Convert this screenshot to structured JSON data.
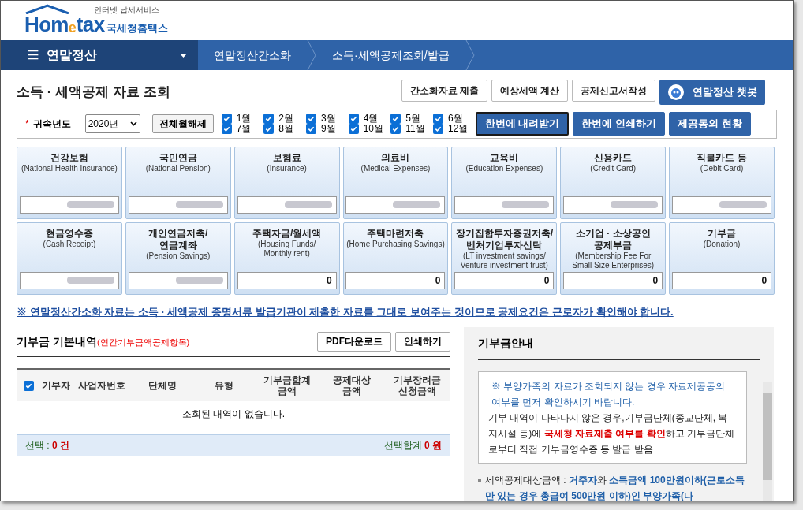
{
  "logo": {
    "tagline": "인터넷 납세서비스",
    "brand_a": "Hom",
    "brand_e": "e",
    "brand_b": "tax",
    "brand_kr": "국세청홈택스"
  },
  "nav": {
    "menu_icon": "☰",
    "menu": "연말정산",
    "crumbs": [
      "연말정산간소화",
      "소득·세액공제조회/발급"
    ]
  },
  "title": "소득 · 세액공제 자료 조회",
  "actions": [
    {
      "label": "간소화자료 제출",
      "kind": "plain"
    },
    {
      "label": "예상세액 계산",
      "kind": "plain"
    },
    {
      "label": "공제신고서작성",
      "kind": "plain"
    },
    {
      "label": "연말정산 챗봇",
      "kind": "chatbot"
    }
  ],
  "filter": {
    "required_mark": "*",
    "label": "귀속년도",
    "year": "2020년",
    "toggle_button": "전체월해제",
    "months": [
      {
        "label": "1월",
        "checked": true
      },
      {
        "label": "2월",
        "checked": true
      },
      {
        "label": "3월",
        "checked": true
      },
      {
        "label": "4월",
        "checked": true
      },
      {
        "label": "5월",
        "checked": true
      },
      {
        "label": "6월",
        "checked": true
      },
      {
        "label": "7월",
        "checked": true
      },
      {
        "label": "8월",
        "checked": true
      },
      {
        "label": "9월",
        "checked": true
      },
      {
        "label": "10월",
        "checked": true
      },
      {
        "label": "11월",
        "checked": true
      },
      {
        "label": "12월",
        "checked": true
      }
    ],
    "buttons": [
      {
        "label": "한번에 내려받기",
        "selected": true
      },
      {
        "label": "한번에 인쇄하기",
        "selected": false
      },
      {
        "label": "제공동의 현황",
        "selected": false
      }
    ]
  },
  "cards": [
    {
      "title": "건강보험",
      "subtitle": "(National Health Insurance)",
      "masked": true
    },
    {
      "title": "국민연금",
      "subtitle": "(National Pension)",
      "masked": true
    },
    {
      "title": "보험료",
      "subtitle": "(Insurance)",
      "masked": true
    },
    {
      "title": "의료비",
      "subtitle": "(Medical Expenses)",
      "masked": true
    },
    {
      "title": "교육비",
      "subtitle": "(Education Expenses)",
      "masked": true
    },
    {
      "title": "신용카드",
      "subtitle": "(Credit Card)",
      "masked": true
    },
    {
      "title": "직불카드 등",
      "subtitle": "(Debit Card)",
      "masked": true
    },
    {
      "title": "현금영수증",
      "subtitle": "(Cash Receipt)",
      "masked": true
    },
    {
      "title": "개인연금저축/\n연금계좌",
      "subtitle": "(Pension Savings)",
      "masked": true
    },
    {
      "title": "주택자금/월세액",
      "subtitle": "(Housing Funds/\nMonthly rent)",
      "value": "0",
      "masked": false
    },
    {
      "title": "주택마련저축",
      "subtitle": "(Home Purchasing Savings)",
      "value": "0",
      "masked": false
    },
    {
      "title": "장기집합투자증권저축/\n벤처기업투자신탁",
      "subtitle": "(LT investment savings/\nVenture investment trust)",
      "value": "0",
      "masked": false
    },
    {
      "title": "소기업 · 소상공인\n공제부금",
      "subtitle": "(Membership Fee For\nSmall Size Enterprises)",
      "value": "0",
      "masked": false
    },
    {
      "title": "기부금",
      "subtitle": "(Donation)",
      "value": "0",
      "masked": false
    }
  ],
  "notice": "※ 연말정산간소화 자료는 소득 · 세액공제 증명서류 발급기관이 제출한 자료를 그대로 보여주는 것이므로 공제요건은 근로자가 확인해야 합니다.",
  "donation": {
    "title": "기부금 기본내역",
    "title_note": "(연간기부금액공제항목)",
    "buttons": [
      "PDF다운로드",
      "인쇄하기"
    ],
    "select_all": true,
    "columns": [
      "기부자",
      "사업자번호",
      "단체명",
      "유형",
      "기부금합계\n금액",
      "공제대상\n금액",
      "기부장려금\n신청금액"
    ],
    "empty": "조회된 내역이 없습니다.",
    "footer": {
      "selected_label": "선택 :",
      "selected_count": "0 건",
      "sum_label": "선택합계",
      "sum_value": "0 원"
    }
  },
  "guide": {
    "title": "기부금안내",
    "box_note": "※ 부양가족의 자료가 조회되지 않는 경우 자료제공동의 여부를 먼저 확인하시기 바랍니다.",
    "box_text": "기부 내역이 나타나지 않은 경우,기부금단체(종교단체, 복지시설 등)에 **국세청 자료제출 여부를 확인**하고 기부금단체로부터 직접 기부금영수증 등 발급 받음",
    "bullet": "세액공제대상금액 : **거주자**와 **소득금액 100만원이하(근로소득만 있는 경우 총급여 500만원 이하)인 부양가족(나**"
  }
}
